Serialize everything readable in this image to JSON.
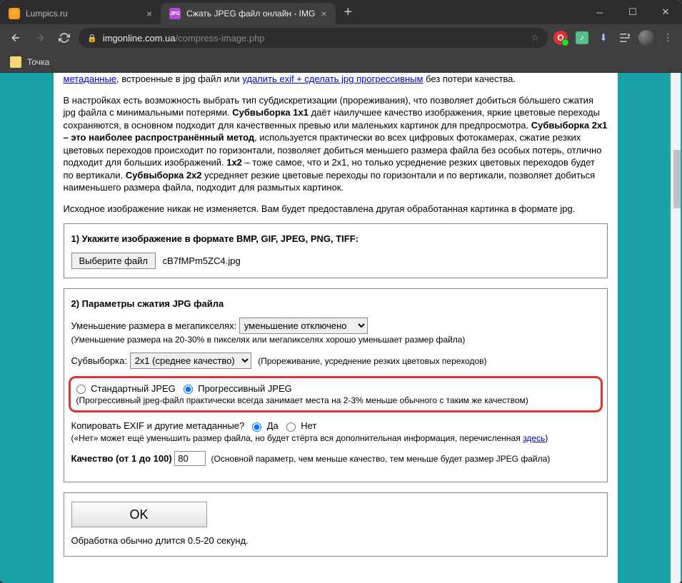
{
  "tabs": [
    {
      "title": "Lumpics.ru"
    },
    {
      "title": "Сжать JPEG файл онлайн - IMG"
    }
  ],
  "url": {
    "domain": "imgonline.com.ua",
    "path": "/compress-image.php"
  },
  "bookmark": "Точка",
  "intro": {
    "link1": "метаданные",
    "text1": ", встроенные в jpg файл или ",
    "link2": "удалить exif + сделать jpg прогрессивным",
    "text2": " без потери качества."
  },
  "para2_a": "В настройках есть возможность выбрать тип субдискретизации (прореживания), что позволяет добиться бо́льшего сжатия jpg файла с минимальными потерями. ",
  "para2_b1": "Субвыборка 1x1",
  "para2_c": " даёт наилучшее качество изображения, яркие цветовые переходы сохраняются, в основном подходит для качественных превью или маленьких картинок для предпросмотра. ",
  "para2_b2": "Субвыборка 2x1 – это наиболее распространённый метод",
  "para2_d": ", используется практически во всех цифровых фотокамерах, сжатие резких цветовых переходов происходит по горизонтали, позволяет добиться меньшего размера файла без особых потерь, отлично подходит для больших изображений. ",
  "para2_b3": "1x2",
  "para2_e": " – тоже самое, что и 2x1, но только усреднение резких цветовых переходов будет по вертикали. ",
  "para2_b4": "Субвыборка 2x2",
  "para2_f": " усредняет резкие цветовые переходы по горизонтали и по вертикали, позволяет добиться наименьшего размера файла, подходит для размытых картинок.",
  "para3": "Исходное изображение никак не изменяется. Вам будет предоставлена другая обработанная картинка в формате jpg.",
  "section1": {
    "heading": "1) Укажите изображение в формате BMP, GIF, JPEG, PNG, TIFF:",
    "file_btn": "Выберите файл",
    "file_name": "cB7fMPm5ZC4.jpg"
  },
  "section2": {
    "heading": "2) Параметры сжатия JPG файла",
    "reduce_label": "Уменьшение размера в мегапикселях:",
    "reduce_value": "уменьшение отключено",
    "reduce_hint": "(Уменьшение размера на 20-30% в пикселях или мегапикселях хорошо уменьшает размер файла)",
    "sub_label": "Субвыборка:",
    "sub_value": "2x1 (среднее качество)",
    "sub_hint": "(Прореживание, усреднение резких цветовых переходов)",
    "jpeg_std": "Стандартный JPEG",
    "jpeg_prog": "Прогрессивный JPEG",
    "jpeg_hint": "(Прогрессивный jpeg-файл практически всегда занимает места на 2-3% меньше обычного с таким же качеством)",
    "exif_label": "Копировать EXIF и другие метаданные?",
    "yes": "Да",
    "no": "Нет",
    "exif_hint_a": "(«Нет» может ещё уменьшить размер файла, но будет стёрта вся дополнительная информация, перечисленная ",
    "exif_hint_link": "здесь",
    "exif_hint_b": ")",
    "quality_label": "Качество (от 1 до 100)",
    "quality_value": "80",
    "quality_hint": "(Основной параметр, чем меньше качество, тем меньше будет размер JPEG файла)"
  },
  "ok": "OK",
  "ok_hint": "Обработка обычно длится 0.5-20 секунд."
}
